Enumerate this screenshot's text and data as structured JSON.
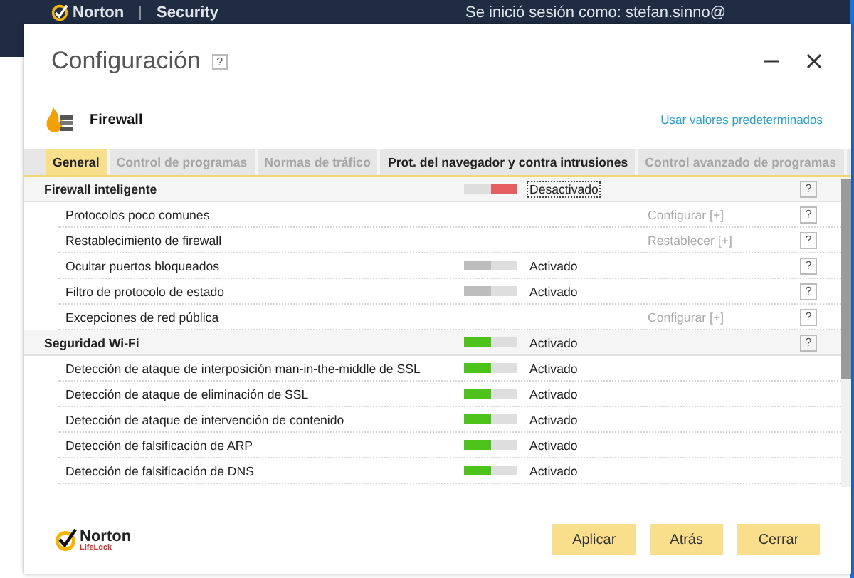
{
  "app_bar": {
    "brand": "Norton",
    "product": "Security",
    "signed_in": "Se inició sesión como: stefan.sinno@"
  },
  "dialog": {
    "title": "Configuración",
    "help": "?",
    "section_title": "Firewall",
    "defaults_link": "Usar valores predeterminados"
  },
  "tabs": [
    {
      "label": "General",
      "selected": true,
      "disabled": false
    },
    {
      "label": "Control de programas",
      "selected": false,
      "disabled": true
    },
    {
      "label": "Normas de tráfico",
      "selected": false,
      "disabled": true
    },
    {
      "label": "Prot. del navegador y contra intrusiones",
      "selected": false,
      "disabled": false
    },
    {
      "label": "Control avanzado de programas",
      "selected": false,
      "disabled": true
    }
  ],
  "sections": [
    {
      "title": "Firewall inteligente",
      "toggle": {
        "on": false,
        "disabled": false,
        "focused": true
      },
      "status": "Desactivado",
      "help": "?",
      "items": [
        {
          "label": "Protocolos poco comunes",
          "action": "Configurar [+]",
          "help": "?"
        },
        {
          "label": "Restablecimiento de firewall",
          "action": "Restablecer [+]",
          "help": "?"
        },
        {
          "label": "Ocultar puertos bloqueados",
          "toggle": {
            "on": true,
            "disabled": true,
            "focused": false
          },
          "status": "Activado",
          "help": "?"
        },
        {
          "label": "Filtro de protocolo de estado",
          "toggle": {
            "on": true,
            "disabled": true,
            "focused": false
          },
          "status": "Activado",
          "help": "?"
        },
        {
          "label": "Excepciones de red pública",
          "action": "Configurar [+]",
          "help": "?"
        }
      ]
    },
    {
      "title": "Seguridad Wi-Fi",
      "toggle": {
        "on": true,
        "disabled": false,
        "focused": false
      },
      "status": "Activado",
      "help": "?",
      "items": [
        {
          "label": "Detección de ataque de interposición man-in-the-middle de SSL",
          "toggle": {
            "on": true,
            "disabled": false,
            "focused": false
          },
          "status": "Activado"
        },
        {
          "label": "Detección de ataque de eliminación de SSL",
          "toggle": {
            "on": true,
            "disabled": false,
            "focused": false
          },
          "status": "Activado"
        },
        {
          "label": "Detección de ataque de intervención de contenido",
          "toggle": {
            "on": true,
            "disabled": false,
            "focused": false
          },
          "status": "Activado"
        },
        {
          "label": "Detección de falsificación de ARP",
          "toggle": {
            "on": true,
            "disabled": false,
            "focused": false
          },
          "status": "Activado"
        },
        {
          "label": "Detección de falsificación de DNS",
          "toggle": {
            "on": true,
            "disabled": false,
            "focused": false
          },
          "status": "Activado"
        }
      ]
    }
  ],
  "footer": {
    "logo": "Norton",
    "logo_sub": "LifeLock",
    "buttons": [
      "Aplicar",
      "Atrás",
      "Cerrar"
    ]
  }
}
